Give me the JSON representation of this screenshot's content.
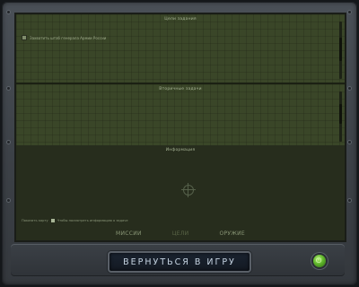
{
  "panels": {
    "objectives_title": "Цели задания",
    "objective_1": "Захватить штаб генерала Армии России",
    "secondary_title": "Вторичные задачи",
    "info_title": "Информация"
  },
  "info": {
    "show_label": "Показать карту",
    "show_hint": "Чтобы посмотреть информацию о задаче"
  },
  "tabs": [
    {
      "label": "МИССИИ",
      "active": false
    },
    {
      "label": "ЦЕЛИ",
      "active": true
    },
    {
      "label": "ОРУЖИЕ",
      "active": false
    }
  ],
  "buttons": {
    "return_label": "ВЕРНУТЬСЯ В ИГРУ",
    "orb_glyph": "⏻"
  },
  "colors": {
    "screen_green": "#3a4628",
    "accent_orb": "#5fb62b"
  }
}
